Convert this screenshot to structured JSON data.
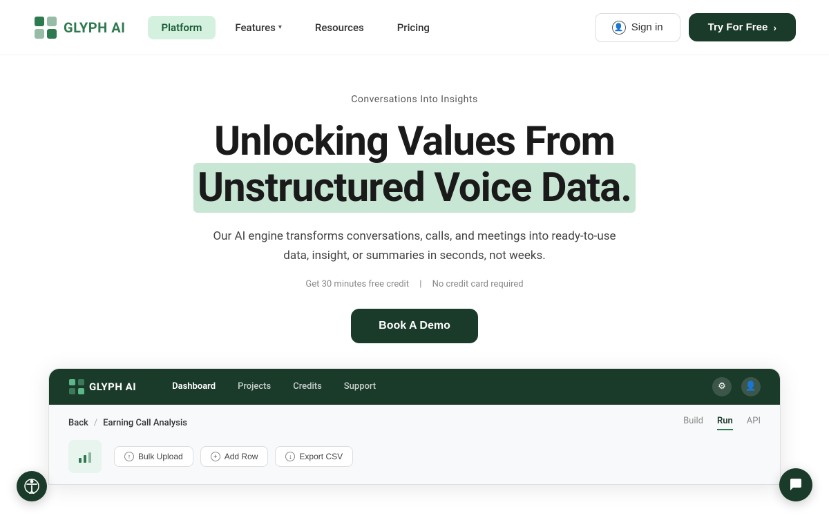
{
  "brand": {
    "name": "GLYPH",
    "suffix": "AI",
    "logo_alt": "Glyph AI Logo"
  },
  "nav": {
    "platform_label": "Platform",
    "features_label": "Features",
    "resources_label": "Resources",
    "pricing_label": "Pricing",
    "sign_in_label": "Sign in",
    "try_free_label": "Try For Free"
  },
  "hero": {
    "subtitle": "Conversations Into Insights",
    "title_line1": "Unlocking Values From",
    "title_line2": "Unstructured Voice Data.",
    "description": "Our AI engine transforms conversations, calls, and meetings into ready-to-use data, insight, or summaries in seconds, not weeks.",
    "note_credit": "Get 30 minutes free credit",
    "note_separator": "|",
    "note_card": "No credit card required",
    "book_demo_label": "Book A Demo"
  },
  "dashboard": {
    "nav": {
      "logo_text": "GLYPH AI",
      "links": [
        {
          "label": "Dashboard",
          "active": true
        },
        {
          "label": "Projects",
          "active": false
        },
        {
          "label": "Credits",
          "active": false
        },
        {
          "label": "Support",
          "active": false
        }
      ]
    },
    "breadcrumb": {
      "back": "Back",
      "separator": "/",
      "page": "Earning Call Analysis"
    },
    "tabs": [
      {
        "label": "Build",
        "active": false
      },
      {
        "label": "Run",
        "active": true
      },
      {
        "label": "API",
        "active": false
      }
    ],
    "toolbar": {
      "bulk_upload": "Bulk Upload",
      "add_row": "Add Row",
      "export_csv": "Export CSV"
    }
  },
  "icons": {
    "chevron_down": "▾",
    "arrow_right": "›",
    "user": "👤",
    "gear": "⚙",
    "bar_chart": "📊",
    "chat": "💬",
    "accessibility": "♿",
    "plus": "+",
    "upload": "↑",
    "download": "↓"
  }
}
